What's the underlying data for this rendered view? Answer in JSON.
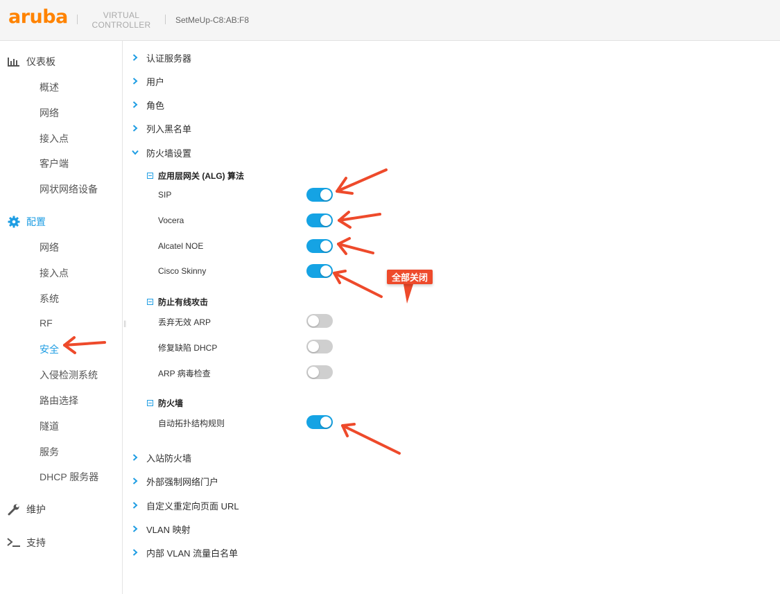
{
  "header": {
    "logo": "aruba",
    "product_line1": "VIRTUAL",
    "product_line2": "CONTROLLER",
    "device_name": "SetMeUp-C8:AB:F8"
  },
  "sidebar": {
    "dashboard": {
      "label": "仪表板",
      "icon": "bar-chart-icon",
      "items": [
        "概述",
        "网络",
        "接入点",
        "客户端",
        "网状网络设备"
      ]
    },
    "config": {
      "label": "配置",
      "icon": "gear-icon",
      "items": [
        "网络",
        "接入点",
        "系统",
        "RF",
        "安全",
        "入侵检测系统",
        "路由选择",
        "隧道",
        "服务",
        "DHCP 服务器"
      ],
      "active_item": "安全"
    },
    "maintenance": {
      "label": "维护",
      "icon": "wrench-icon"
    },
    "support": {
      "label": "支持",
      "icon": "terminal-icon"
    }
  },
  "main": {
    "sections_top": [
      "认证服务器",
      "用户",
      "角色",
      "列入黑名单"
    ],
    "firewall_settings": {
      "label": "防火墙设置",
      "alg": {
        "label": "应用层网关 (ALG) 算法",
        "options": [
          {
            "label": "SIP",
            "on": true
          },
          {
            "label": "Vocera",
            "on": true
          },
          {
            "label": "Alcatel NOE",
            "on": true
          },
          {
            "label": "Cisco Skinny",
            "on": true
          }
        ]
      },
      "wired_attack": {
        "label": "防止有线攻击",
        "options": [
          {
            "label": "丢弃无效 ARP",
            "on": false
          },
          {
            "label": "修复缺陷 DHCP",
            "on": false
          },
          {
            "label": "ARP 病毒检查",
            "on": false
          }
        ]
      },
      "firewall": {
        "label": "防火墙",
        "options": [
          {
            "label": "自动拓扑结构规则",
            "on": true
          }
        ]
      }
    },
    "sections_bottom": [
      "入站防火墙",
      "外部强制网络门户",
      "自定义重定向页面 URL",
      "VLAN 映射",
      "内部 VLAN 流量白名单"
    ]
  },
  "annotation": {
    "callout": "全部关闭",
    "arrow_color": "#ee4a2b"
  },
  "colors": {
    "accent": "#1e9de3",
    "toggle_on": "#15a3e4",
    "toggle_off": "#cfcfcf",
    "brand": "#ff8300"
  }
}
